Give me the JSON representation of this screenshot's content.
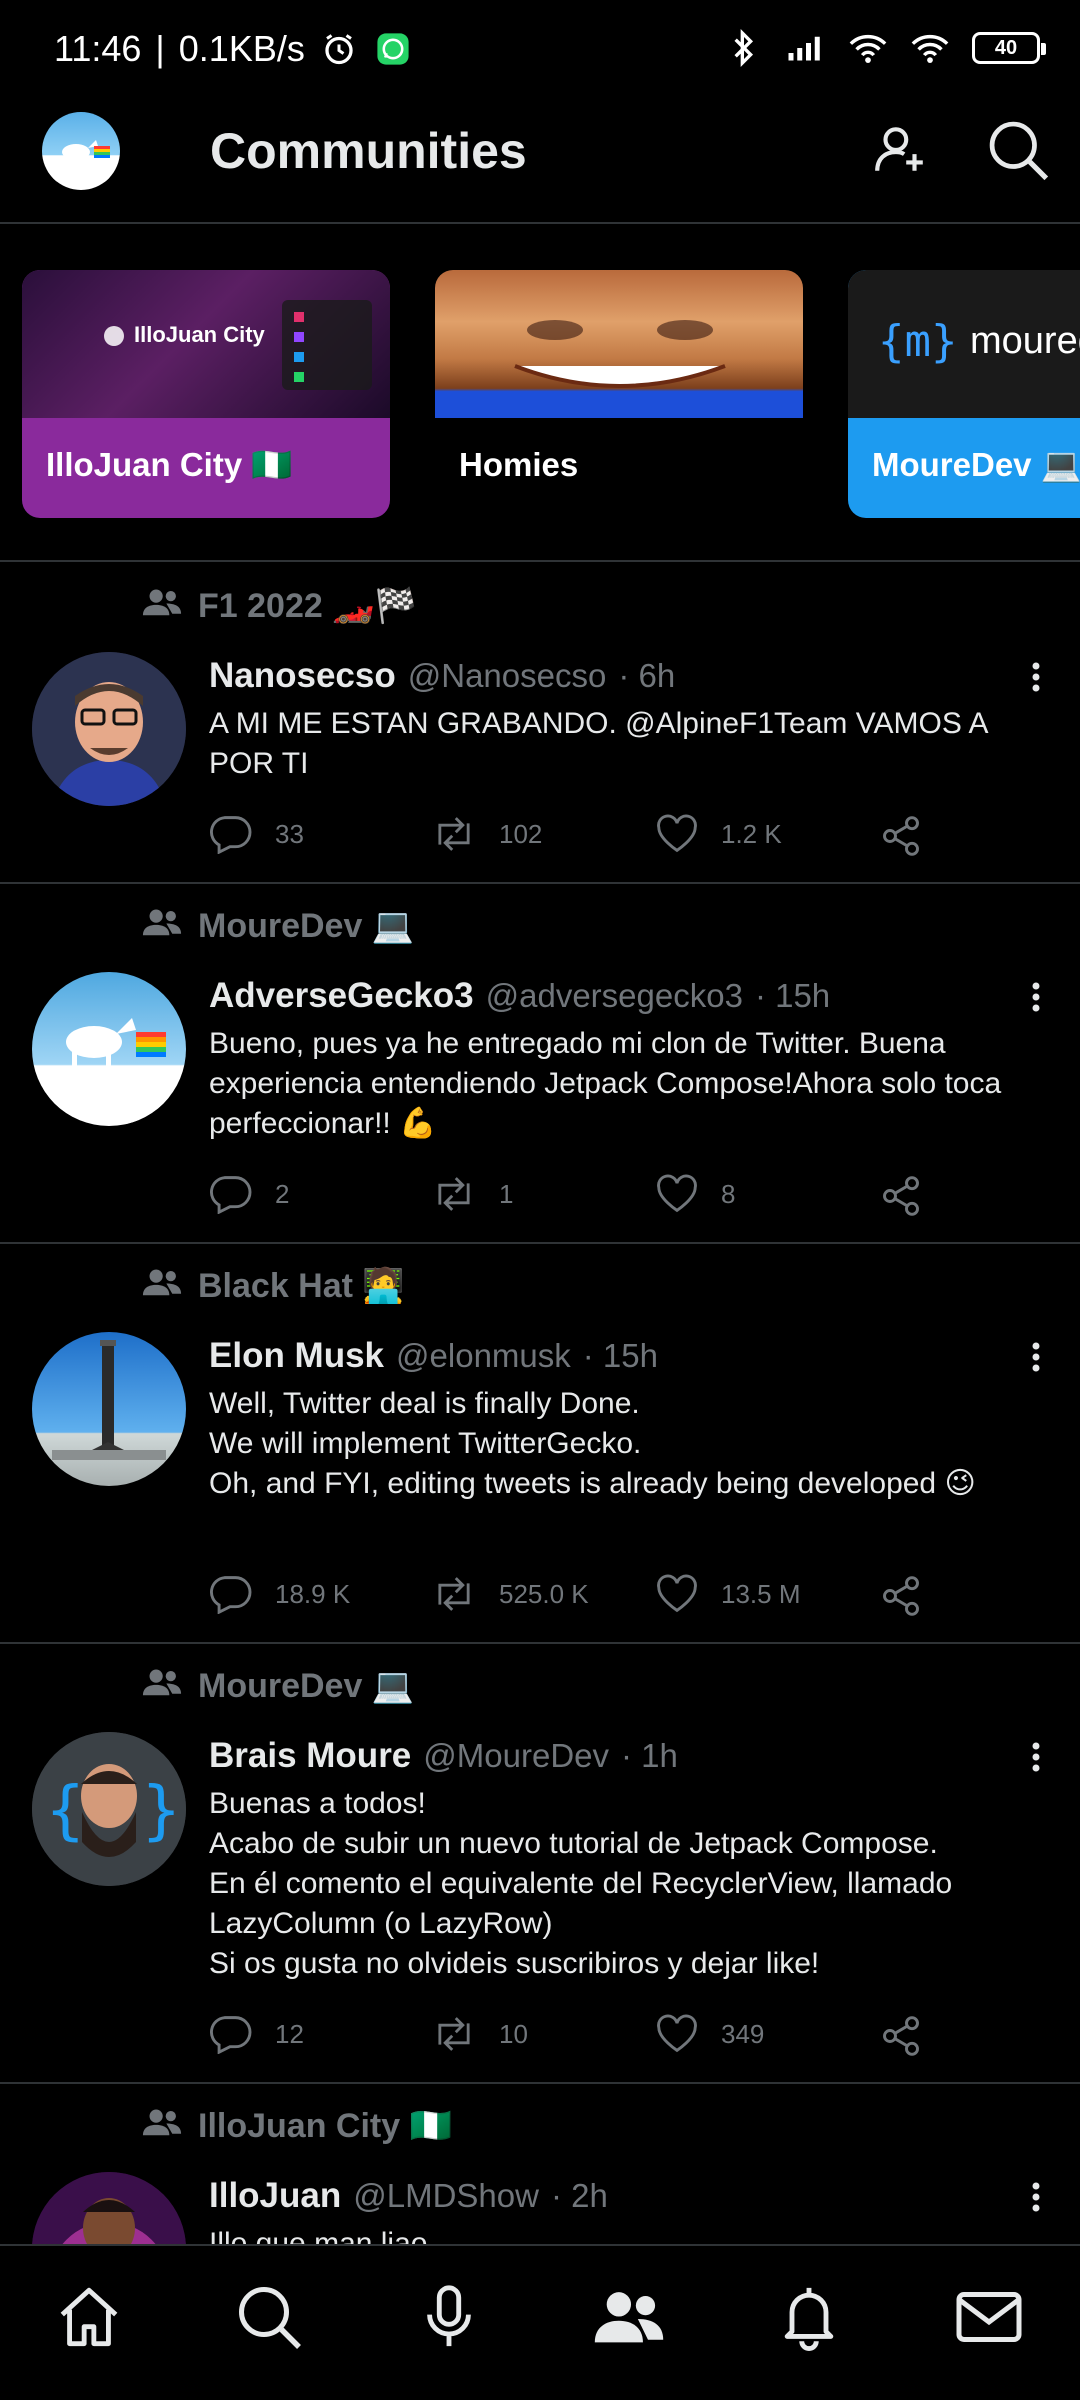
{
  "status_bar": {
    "time": "11:46",
    "separator": "|",
    "speed": "0.1KB/s",
    "battery": "40",
    "icons": [
      "alarm-icon",
      "whatsapp-icon",
      "bluetooth-icon",
      "signal-icon",
      "wifi-icon",
      "wifi-icon",
      "battery-icon"
    ]
  },
  "header": {
    "title": "Communities",
    "actions": [
      "add-member-icon",
      "search-icon"
    ]
  },
  "communities": [
    {
      "name": "IlloJuan City 🇳🇬",
      "banner_text": "IlloJuan City",
      "color": "#8a2a9c"
    },
    {
      "name": "Homies",
      "color": "#000000"
    },
    {
      "name": "MoureDev 💻",
      "banner_text": "moured",
      "color": "#1d9bf0"
    }
  ],
  "posts": [
    {
      "community": "F1 2022 🏎️🏁",
      "name": "Nanosecso",
      "handle": "@Nanosecso",
      "time": "· 6h",
      "text": "A MI ME ESTAN GRABANDO. @AlpineF1Team VAMOS A POR TI",
      "replies": "33",
      "retweets": "102",
      "likes": "1.2 K"
    },
    {
      "community": "MoureDev 💻",
      "name": "AdverseGecko3",
      "handle": "@adversegecko3",
      "time": "· 15h",
      "text": "Bueno, pues ya he entregado mi clon de Twitter. Buena experiencia entendiendo Jetpack Compose!Ahora solo toca perfeccionar!! 💪",
      "replies": "2",
      "retweets": "1",
      "likes": "8"
    },
    {
      "community": "Black Hat 🧑‍💻",
      "name": "Elon Musk",
      "handle": "@elonmusk",
      "time": "· 15h",
      "text": "Well, Twitter deal is finally Done.\nWe will implement TwitterGecko.\nOh, and FYI, editing tweets is already being developed 😉",
      "replies": "18.9 K",
      "retweets": "525.0 K",
      "likes": "13.5 M"
    },
    {
      "community": "MoureDev 💻",
      "name": "Brais Moure",
      "handle": "@MoureDev",
      "time": "· 1h",
      "text": "Buenas a todos!\nAcabo de subir un nuevo tutorial de Jetpack Compose.\nEn él comento el equivalente del RecyclerView, llamado LazyColumn (o LazyRow)\nSi os gusta no olvideis suscribiros y dejar like!",
      "replies": "12",
      "retweets": "10",
      "likes": "349"
    },
    {
      "community": "IlloJuan City 🇳🇬",
      "name": "IlloJuan",
      "handle": "@LMDShow",
      "time": "· 2h",
      "text": "Illo que man liao",
      "replies": "",
      "retweets": "",
      "likes": ""
    }
  ],
  "bottom_nav": {
    "items": [
      "home-icon",
      "search-icon",
      "spaces-mic-icon",
      "communities-icon",
      "notifications-bell-icon",
      "messages-mail-icon"
    ],
    "active": "communities-icon"
  },
  "colors": {
    "background": "#000000",
    "divider": "#2f3336",
    "muted": "#71767b",
    "text": "#e7e9ea",
    "accent": "#1d9bf0"
  }
}
